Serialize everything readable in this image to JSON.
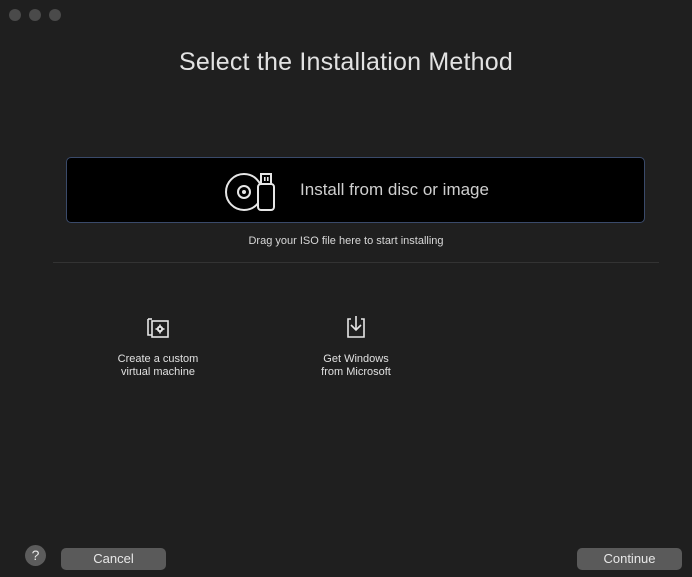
{
  "window": {
    "title": "Select the Installation Method"
  },
  "disc_option": {
    "label": "Install from disc or image",
    "icon": "disc-usb-icon"
  },
  "drag_hint": "Drag your ISO file here to start installing",
  "options": [
    {
      "label": "Create a custom\nvirtual machine",
      "icon": "custom-vm-icon"
    },
    {
      "label": "Get Windows\nfrom Microsoft",
      "icon": "download-icon"
    }
  ],
  "footer": {
    "help_label": "?",
    "cancel_label": "Cancel",
    "continue_label": "Continue"
  },
  "colors": {
    "background": "#1f1f1f",
    "disc_box_background": "#000000",
    "disc_box_border": "#3a4a6a",
    "button_background": "#5a5a5a"
  }
}
